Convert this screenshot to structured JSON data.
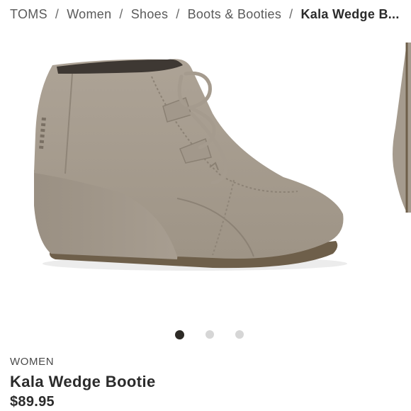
{
  "breadcrumb": {
    "items": [
      "TOMS",
      "Women",
      "Shoes",
      "Boots & Booties"
    ],
    "separator": "/",
    "current": "Kala Wedge B..."
  },
  "carousel": {
    "slide_count": 3,
    "active_index": 0,
    "image_alt": "Kala Wedge Bootie side view"
  },
  "product": {
    "category": "WOMEN",
    "name": "Kala Wedge Bootie",
    "price": "$89.95"
  },
  "colors": {
    "suede": "#a79d90",
    "sole": "#6e5f4a",
    "dot_active": "#2d2a26",
    "dot_inactive": "#d6d6d6"
  }
}
